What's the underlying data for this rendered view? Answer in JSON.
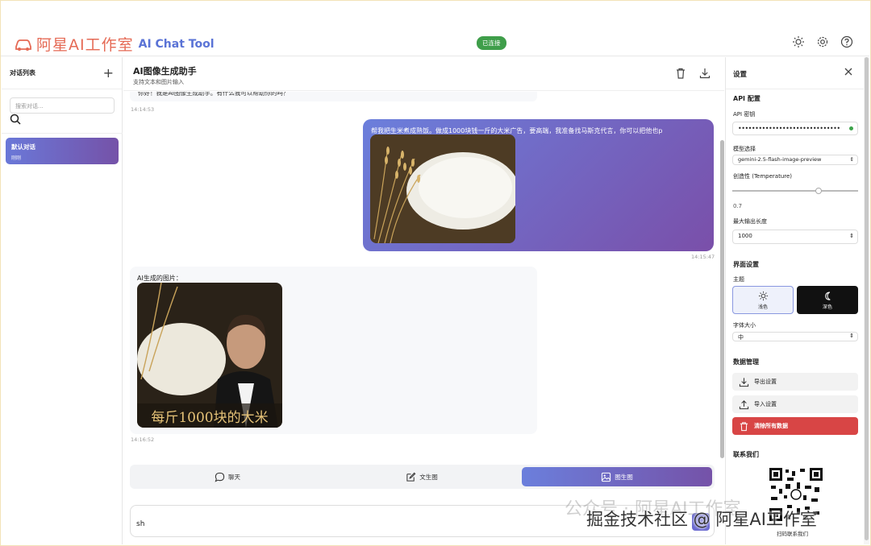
{
  "header": {
    "brand": "阿星AI工作室",
    "product": "AI Chat Tool",
    "status": "已连接"
  },
  "sidebar": {
    "title": "对话列表",
    "add": "+",
    "search_placeholder": "搜索对话...",
    "conversations": [
      {
        "title": "默认对话",
        "time": "刚刚"
      }
    ]
  },
  "main": {
    "title": "AI图像生成助手",
    "subtitle": "支持文本和图片输入",
    "messages": {
      "ai_top_text": "你好！我是AI图像生成助手。有什么我可以帮助你的吗？",
      "ai_top_time": "14:14:53",
      "user_text": "帮我把生米煮成熟饭。做成1000块钱一斤的大米广告，要高端，我准备找马斯克代言，你可以把他也p",
      "user_time": "14:15:47",
      "ai_label": "AI生成的图片：",
      "ai_image_caption": "每斤1000块的大米",
      "ai_time": "14:16:52"
    },
    "modes": [
      {
        "label": "聊天",
        "icon": "chat-icon",
        "active": false
      },
      {
        "label": "文生图",
        "icon": "edit-icon",
        "active": false
      },
      {
        "label": "图生图",
        "icon": "image-icon",
        "active": true
      }
    ],
    "input_value": "sh"
  },
  "settings": {
    "title": "设置",
    "api_section": "API 配置",
    "api_key_label": "API 密钥",
    "api_key_value": "••••••••••••••••••••••••••••••",
    "model_label": "模型选择",
    "model_value": "gemini-2.5-flash-image-preview",
    "temperature_label": "创造性 (Temperature)",
    "temperature_value": "0.7",
    "temperature_fraction": 0.7,
    "max_tokens_label": "最大输出长度",
    "max_tokens_value": "1000",
    "ui_section": "界面设置",
    "theme_label": "主题",
    "theme_light": "浅色",
    "theme_dark": "深色",
    "font_size_label": "字体大小",
    "font_size_value": "中",
    "data_section": "数据管理",
    "export": "导出设置",
    "import": "导入设置",
    "clear": "清除所有数据",
    "contact_section": "联系我们",
    "qr_caption": "扫码联系我们"
  },
  "watermark": {
    "line1": "公众号 · 阿星AI工作室",
    "line2": "掘金技术社区 @ 阿星AI工作室"
  },
  "colors": {
    "accent_start": "#6b7fdc",
    "accent_end": "#7552a8",
    "status_green": "#3f9e4a",
    "danger": "#d84545",
    "brand_red": "#e56a55"
  }
}
